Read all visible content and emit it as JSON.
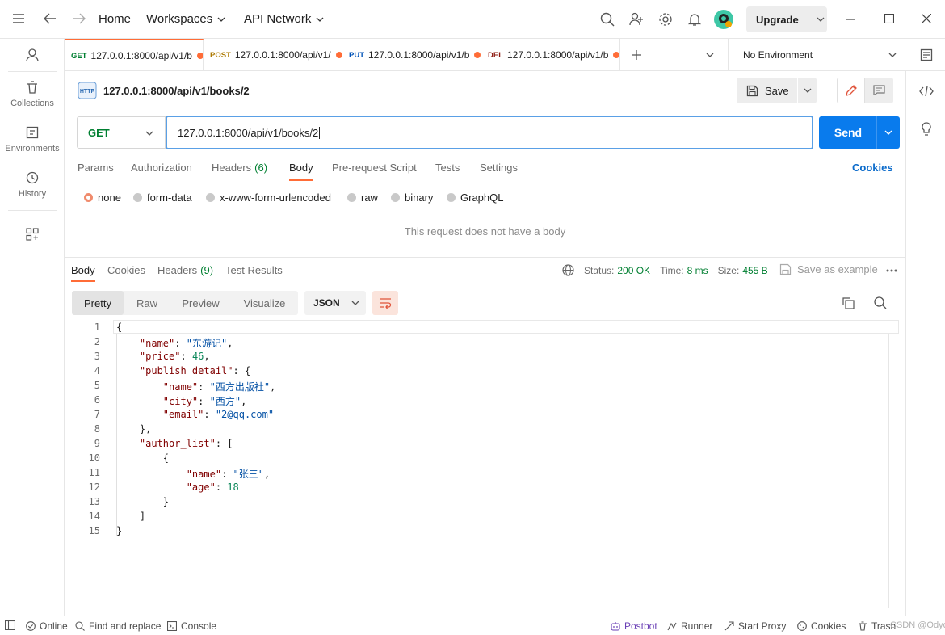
{
  "titlebar": {
    "home": "Home",
    "workspaces": "Workspaces",
    "api_network": "API Network",
    "upgrade": "Upgrade"
  },
  "sidebar": {
    "items": [
      {
        "label": "Collections"
      },
      {
        "label": "Environments"
      },
      {
        "label": "History"
      }
    ]
  },
  "tabs": [
    {
      "method": "GET",
      "method_color": "#007f31",
      "label": "127.0.0.1:8000/api/v1/b"
    },
    {
      "method": "POST",
      "method_color": "#ad7a03",
      "label": "127.0.0.1:8000/api/v1/"
    },
    {
      "method": "PUT",
      "method_color": "#0053b8",
      "label": "127.0.0.1:8000/api/v1/b"
    },
    {
      "method": "DEL",
      "method_color": "#8e1a10",
      "label": "127.0.0.1:8000/api/v1/b"
    }
  ],
  "environment": "No Environment",
  "request": {
    "http_badge": "HTTP",
    "name": "127.0.0.1:8000/api/v1/books/2",
    "save_label": "Save",
    "method": "GET",
    "url": "127.0.0.1:8000/api/v1/books/2",
    "send_label": "Send",
    "subtabs": [
      "Params",
      "Authorization",
      "Headers",
      "Body",
      "Pre-request Script",
      "Tests",
      "Settings"
    ],
    "headers_count": "(6)",
    "cookies_link": "Cookies",
    "body_options": [
      "none",
      "form-data",
      "x-www-form-urlencoded",
      "raw",
      "binary",
      "GraphQL"
    ],
    "no_body_text": "This request does not have a body"
  },
  "response": {
    "tabs": [
      "Body",
      "Cookies",
      "Headers",
      "Test Results"
    ],
    "headers_count": "(9)",
    "status_label": "Status:",
    "status_value": "200 OK",
    "time_label": "Time:",
    "time_value": "8 ms",
    "size_label": "Size:",
    "size_value": "455 B",
    "save_example": "Save as example",
    "views": [
      "Pretty",
      "Raw",
      "Preview",
      "Visualize"
    ],
    "format": "JSON",
    "line_numbers": [
      "1",
      "2",
      "3",
      "4",
      "5",
      "6",
      "7",
      "8",
      "9",
      "10",
      "11",
      "12",
      "13",
      "14",
      "15"
    ],
    "json": {
      "name_key": "\"name\"",
      "name_val": "\"东游记\"",
      "price_key": "\"price\"",
      "price_val": "46",
      "publish_key": "\"publish_detail\"",
      "pub_name_key": "\"name\"",
      "pub_name_val": "\"西方出版社\"",
      "pub_city_key": "\"city\"",
      "pub_city_val": "\"西方\"",
      "pub_email_key": "\"email\"",
      "pub_email_val": "\"2@qq.com\"",
      "author_key": "\"author_list\"",
      "au_name_key": "\"name\"",
      "au_name_val": "\"张三\"",
      "au_age_key": "\"age\"",
      "au_age_val": "18"
    }
  },
  "statusbar": {
    "online": "Online",
    "find": "Find and replace",
    "console": "Console",
    "postbot": "Postbot",
    "runner": "Runner",
    "proxy": "Start Proxy",
    "cookies": "Cookies",
    "trash": "Trash",
    "watermark": "CSDN @Odycher"
  }
}
